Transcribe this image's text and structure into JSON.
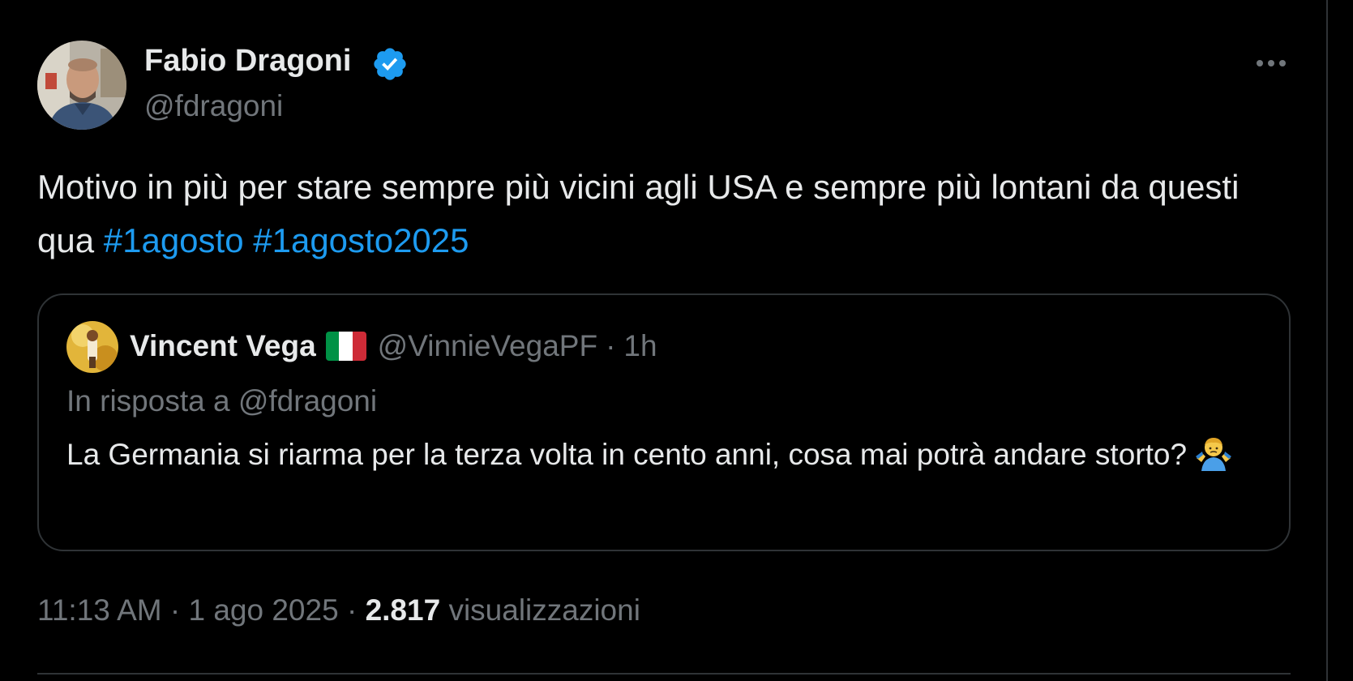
{
  "tweet": {
    "author": {
      "name": "Fabio Dragoni",
      "handle": "@fdragoni",
      "verified": true
    },
    "text_plain": "Motivo in più per stare sempre più vicini agli USA e sempre più lontani da questi qua",
    "hashtags": [
      "#1agosto",
      "#1agosto2025"
    ],
    "more_icon": "more-horizontal-icon",
    "quoted": {
      "name": "Vincent Vega",
      "flag": "italy-flag-icon",
      "handle": "@VinnieVegaPF",
      "separator": "·",
      "time": "1h",
      "reply_to": "In risposta a @fdragoni",
      "text": "La Germania si riarma per la terza volta in cento anni, cosa mai potrà andare storto?",
      "emoji": "person-shrugging-emoji"
    },
    "meta": {
      "time": "11:13 AM",
      "separator": "·",
      "date": "1 ago 2025",
      "views_count": "2.817",
      "views_label": "visualizzazioni"
    }
  },
  "colors": {
    "background": "#000000",
    "text_primary": "#e7e9ea",
    "text_secondary": "#71767b",
    "accent": "#1d9bf0",
    "border": "#2f3336"
  }
}
